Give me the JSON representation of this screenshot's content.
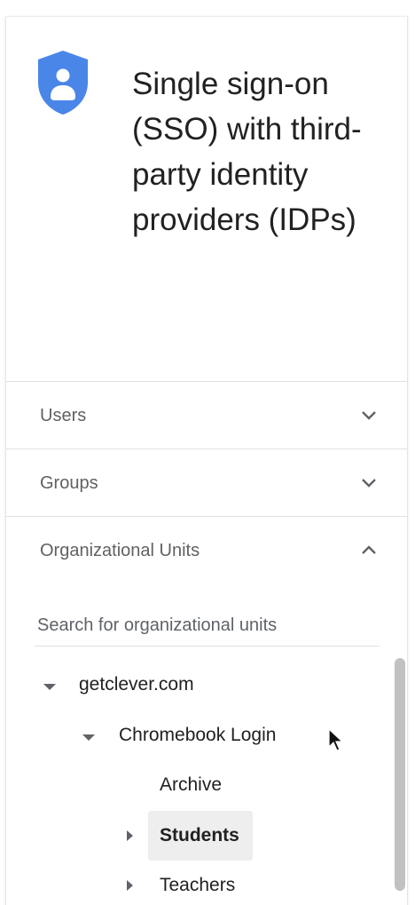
{
  "header": {
    "icon": "shield-user-icon",
    "title": "Single sign-on (SSO) with third-party identity providers (IDPs)"
  },
  "sections": [
    {
      "label": "Users",
      "icon": "chevron-down-icon",
      "expanded": false
    },
    {
      "label": "Groups",
      "icon": "chevron-down-icon",
      "expanded": false
    },
    {
      "label": "Organizational Units",
      "icon": "chevron-up-icon",
      "expanded": true
    }
  ],
  "org_units": {
    "search_placeholder": "Search for organizational units",
    "tree": {
      "root": {
        "label": "getclever.com",
        "expanded": true
      },
      "child": {
        "label": "Chromebook Login",
        "expanded": true
      },
      "leaves": [
        {
          "label": "Archive",
          "has_children": false,
          "selected": false
        },
        {
          "label": "Students",
          "has_children": true,
          "selected": true
        },
        {
          "label": "Teachers",
          "has_children": true,
          "selected": false
        }
      ]
    }
  },
  "colors": {
    "shield_blue": "#4a86e8",
    "selected_bg": "#eeeeee",
    "divider": "#e0e0e0"
  }
}
